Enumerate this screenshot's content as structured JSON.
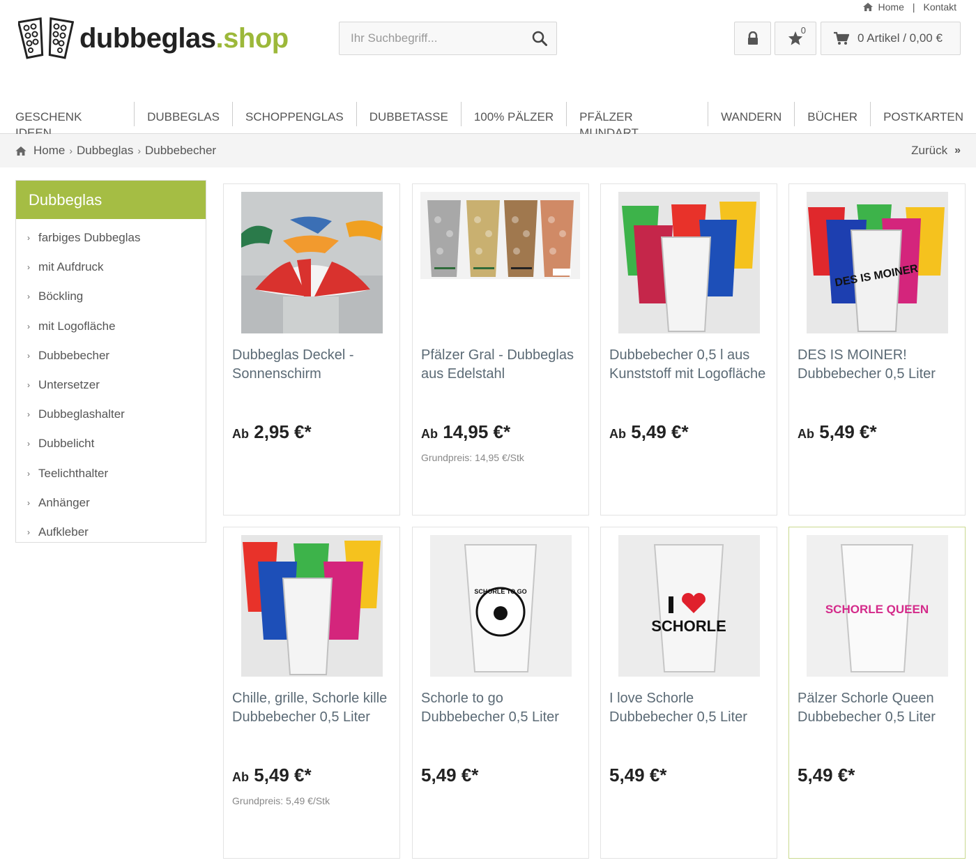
{
  "service": {
    "home": "Home",
    "separator": "|",
    "contact": "Kontakt"
  },
  "logo": {
    "part1": "dubbeglas",
    "part2": ".shop"
  },
  "search": {
    "placeholder": "Ihr Suchbegriff..."
  },
  "header": {
    "wishlist_count": "0",
    "cart_label": "0 Artikel / 0,00 €"
  },
  "nav": [
    "GESCHENK IDEEN",
    "DUBBEGLAS",
    "SCHOPPENGLAS",
    "DUBBETASSE",
    "100% PÄLZER",
    "PFÄLZER MUNDART",
    "WANDERN",
    "BÜCHER",
    "POSTKARTEN"
  ],
  "breadcrumb": {
    "items": [
      "Home",
      "Dubbeglas",
      "Dubbebecher"
    ],
    "sep": "›",
    "back": "Zurück",
    "back_icon": "»"
  },
  "sidebar": {
    "title": "Dubbeglas",
    "arrow": "›",
    "items": [
      "farbiges Dubbeglas",
      "mit Aufdruck",
      "Böckling",
      "mit Logofläche",
      "Dubbebecher",
      "Untersetzer",
      "Dubbeglashalter",
      "Dubbelicht",
      "Teelichthalter",
      "Anhänger",
      "Aufkleber"
    ]
  },
  "products": [
    {
      "title": "Dubbeglas Deckel - Sonnenschirm",
      "prefix": "Ab",
      "price": "2,95 €*",
      "base": "",
      "image": "umbrella-lids"
    },
    {
      "title": "Pfälzer Gral - Dubbeglas aus Edelstahl",
      "prefix": "Ab",
      "price": "14,95 €*",
      "base": "Grundpreis: 14,95 €/Stk",
      "image": "steel-glasses"
    },
    {
      "title": "Dubbebecher 0,5 l aus Kunststoff mit Logofläche",
      "prefix": "Ab",
      "price": "5,49 €*",
      "base": "",
      "image": "colored-cups"
    },
    {
      "title": "DES IS MOINER! Dubbebecher 0,5 Liter",
      "prefix": "Ab",
      "price": "5,49 €*",
      "base": "",
      "image": "des-is-moiner-cups",
      "image_text": "DES IS MOINER"
    },
    {
      "title": "Chille, grille, Schorle kille Dubbebecher 0,5 Liter",
      "prefix": "Ab",
      "price": "5,49 €*",
      "base": "Grundpreis: 5,49 €/Stk",
      "image": "chille-cups"
    },
    {
      "title": "Schorle to go Dubbebecher 0,5 Liter",
      "prefix": "",
      "price": "5,49 €*",
      "base": "",
      "image": "schorle-to-go-cup",
      "image_text": "SCHORLE TO GO"
    },
    {
      "title": "I love Schorle Dubbebecher 0,5 Liter",
      "prefix": "",
      "price": "5,49 €*",
      "base": "",
      "image": "i-love-schorle-cup",
      "image_text": "SCHORLE"
    },
    {
      "title": "Pälzer Schorle Queen Dubbebecher 0,5 Liter",
      "prefix": "",
      "price": "5,49 €*",
      "base": "",
      "image": "schorle-queen-cup",
      "image_text": "SCHORLE QUEEN"
    }
  ],
  "colors": {
    "accent": "#a5bd44",
    "logo_green": "#9cb83a",
    "title": "#5b6a75"
  }
}
